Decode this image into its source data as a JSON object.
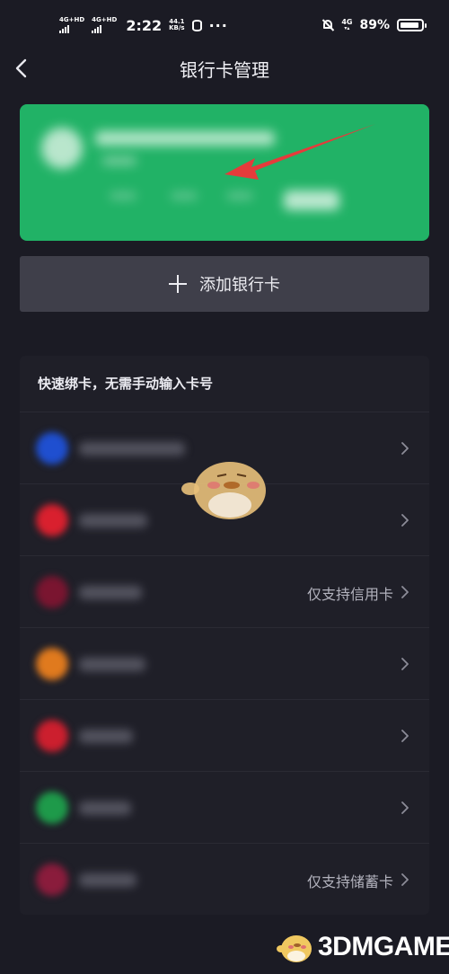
{
  "status_bar": {
    "sim1": "4G+HD",
    "sim2": "4G+HD",
    "time": "2:22",
    "speed_value": "44.1",
    "speed_unit": "KB/s",
    "more": "···",
    "network": "4G",
    "battery": "89%",
    "battery_level": 0.89,
    "icons": [
      "signal-icon",
      "signal-icon",
      "database-icon",
      "mute-bell-icon",
      "battery-icon"
    ]
  },
  "header": {
    "title": "银行卡管理",
    "back_icon": "chevron-left-icon"
  },
  "card": {
    "color": "#21b266",
    "arrow_color": "#e53b3b"
  },
  "add_card": {
    "label": "添加银行卡",
    "icon": "plus-icon"
  },
  "quick_bind": {
    "title": "快速绑卡，无需手动输入卡号",
    "rows": [
      {
        "icon_color": "#1f4fd0",
        "note": ""
      },
      {
        "icon_color": "#d9202e",
        "note": ""
      },
      {
        "icon_color": "#7a1530",
        "note": "仅支持信用卡"
      },
      {
        "icon_color": "#e07a1e",
        "note": ""
      },
      {
        "icon_color": "#cc1f2e",
        "note": ""
      },
      {
        "icon_color": "#1e9a4a",
        "note": ""
      },
      {
        "icon_color": "#8a1c3c",
        "note": "仅支持储蓄卡"
      }
    ]
  },
  "watermark": {
    "text": "3DMGAME"
  }
}
